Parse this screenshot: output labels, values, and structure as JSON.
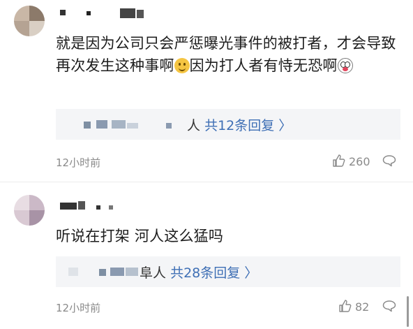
{
  "comments": [
    {
      "text_before_emoji": "就是因为公司只会严惩曝光事件的被打者，才会导致再次发生这种事啊",
      "text_mid": "因为打人者有恃无恐啊",
      "emoji1": "smile-emoji",
      "emoji2": "scared-emoji",
      "reply_partial": "人",
      "reply_count_label": "共12条回复",
      "time": "12小时前",
      "likes": "260"
    },
    {
      "text": "听说在打架 河人这么猛吗",
      "reply_partial": "阜人",
      "reply_count_label": "共28条回复",
      "time": "12小时前",
      "likes": "82"
    }
  ],
  "icons": {
    "chevron": "chevron-right-icon",
    "like": "thumbs-up-icon",
    "reply": "reply-bubble-icon"
  },
  "colors": {
    "accent": "#3e6fb5",
    "meta": "#8a8a8a",
    "reply_bg": "#f4f5f7"
  }
}
